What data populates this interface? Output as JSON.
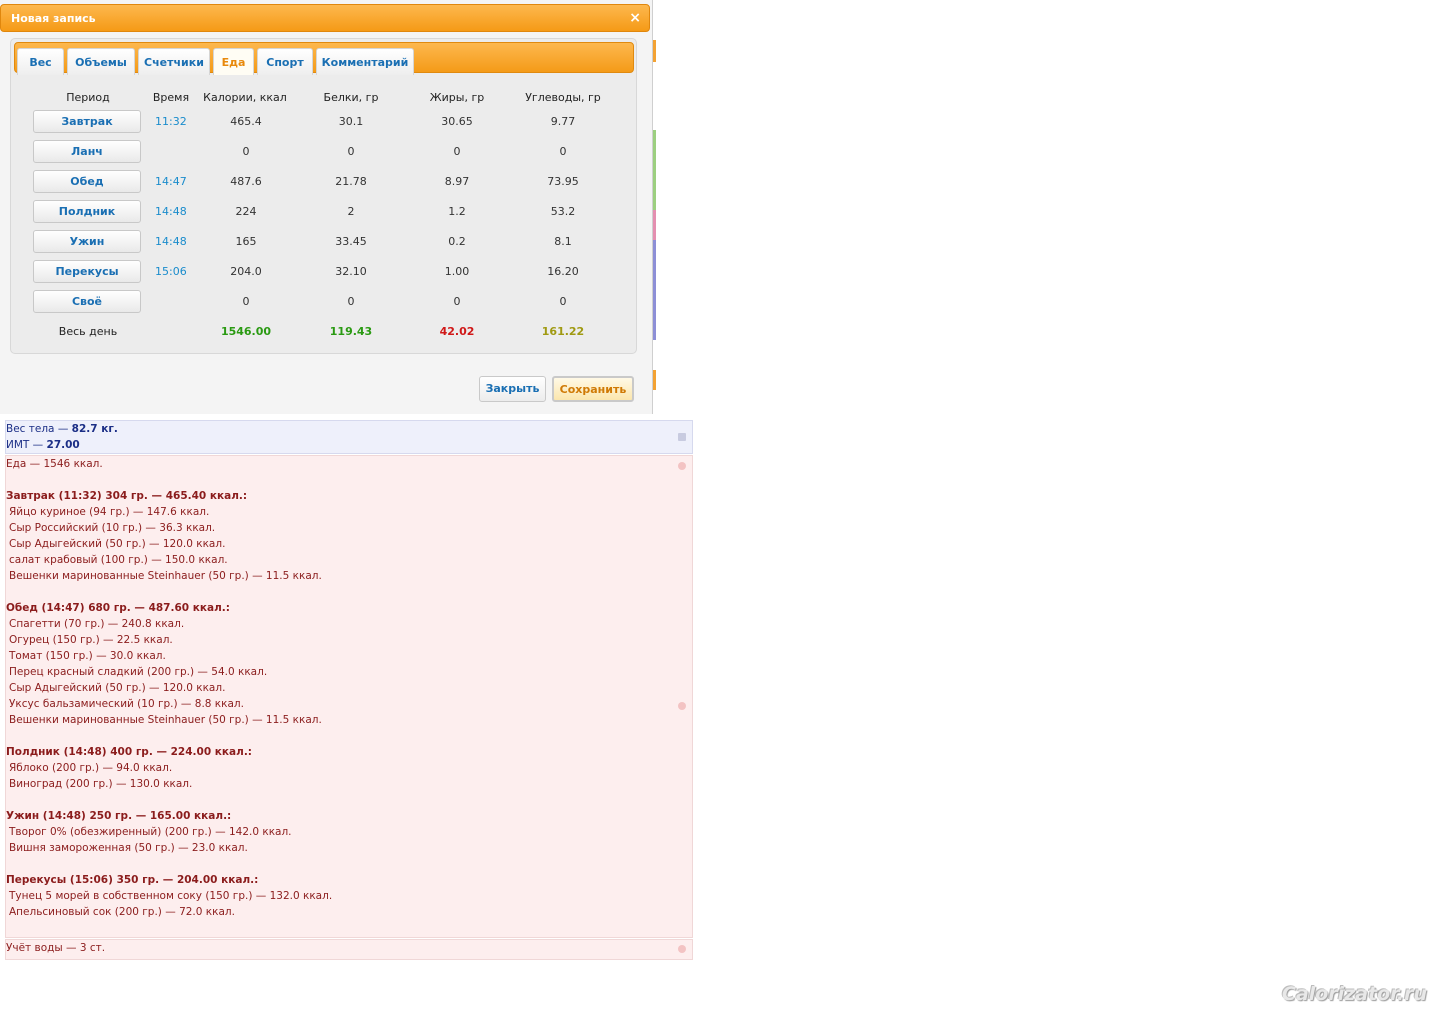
{
  "dialog": {
    "title": "Новая запись",
    "close_icon": "×",
    "tabs": [
      {
        "label": "Вес"
      },
      {
        "label": "Объемы"
      },
      {
        "label": "Счетчики"
      },
      {
        "label": "Еда",
        "active": true
      },
      {
        "label": "Спорт"
      },
      {
        "label": "Комментарий"
      }
    ],
    "table": {
      "headers": [
        "Период",
        "Время",
        "Калории, ккал",
        "Белки, гр",
        "Жиры, гр",
        "Углеводы, гр"
      ],
      "rows": [
        {
          "period": "Завтрак",
          "time": "11:32",
          "kcal": "465.4",
          "protein": "30.1",
          "fat": "30.65",
          "carbs": "9.77"
        },
        {
          "period": "Ланч",
          "time": "",
          "kcal": "0",
          "protein": "0",
          "fat": "0",
          "carbs": "0"
        },
        {
          "period": "Обед",
          "time": "14:47",
          "kcal": "487.6",
          "protein": "21.78",
          "fat": "8.97",
          "carbs": "73.95"
        },
        {
          "period": "Полдник",
          "time": "14:48",
          "kcal": "224",
          "protein": "2",
          "fat": "1.2",
          "carbs": "53.2"
        },
        {
          "period": "Ужин",
          "time": "14:48",
          "kcal": "165",
          "protein": "33.45",
          "fat": "0.2",
          "carbs": "8.1"
        },
        {
          "period": "Перекусы",
          "time": "15:06",
          "kcal": "204.0",
          "protein": "32.10",
          "fat": "1.00",
          "carbs": "16.20"
        },
        {
          "period": "Своё",
          "time": "",
          "kcal": "0",
          "protein": "0",
          "fat": "0",
          "carbs": "0"
        }
      ],
      "total": {
        "label": "Весь день",
        "kcal": "1546.00",
        "protein": "119.43",
        "fat": "42.02",
        "carbs": "161.22"
      }
    },
    "buttons": {
      "close": "Закрыть",
      "save": "Сохранить"
    },
    "colors": {
      "accent": "#f59a16",
      "link": "#1a6fb3",
      "kcal_total": "#2a9a12",
      "protein_total": "#2a9a12",
      "fat_total": "#d01818",
      "carbs_total": "#a09a12"
    }
  },
  "diary": {
    "weight": [
      {
        "text": "Вес тела — ",
        "value": "82.7 кг."
      },
      {
        "text": "ИМТ — ",
        "value": "27.00"
      }
    ],
    "food": [
      {
        "text": "Еда — 1546 ккал.",
        "bold": false
      },
      {
        "text": "",
        "bold": false
      },
      {
        "text": "Завтрак (11:32) 304 гр. — 465.40 ккал.:",
        "bold": true
      },
      {
        "text": "Яйцо куриное (94 гр.) — 147.6 ккал.",
        "item": true
      },
      {
        "text": "Сыр Российский (10 гр.) — 36.3 ккал.",
        "item": true
      },
      {
        "text": "Сыр Адыгейский (50 гр.) — 120.0 ккал.",
        "item": true
      },
      {
        "text": "салат крабовый (100 гр.) — 150.0 ккал.",
        "item": true
      },
      {
        "text": "Вешенки маринованные Steinhauer (50 гр.) — 11.5 ккал.",
        "item": true
      },
      {
        "text": "",
        "bold": false
      },
      {
        "text": "Обед (14:47) 680 гр. — 487.60 ккал.:",
        "bold": true
      },
      {
        "text": "Спагетти (70 гр.) — 240.8 ккал.",
        "item": true
      },
      {
        "text": "Огурец (150 гр.) — 22.5 ккал.",
        "item": true
      },
      {
        "text": "Томат (150 гр.) — 30.0 ккал.",
        "item": true
      },
      {
        "text": "Перец красный сладкий (200 гр.) — 54.0 ккал.",
        "item": true
      },
      {
        "text": "Сыр Адыгейский (50 гр.) — 120.0 ккал.",
        "item": true
      },
      {
        "text": "Уксус бальзамический (10 гр.) — 8.8 ккал.",
        "item": true
      },
      {
        "text": "Вешенки маринованные Steinhauer (50 гр.) — 11.5 ккал.",
        "item": true
      },
      {
        "text": "",
        "bold": false
      },
      {
        "text": "Полдник (14:48) 400 гр. — 224.00 ккал.:",
        "bold": true
      },
      {
        "text": "Яблоко (200 гр.) — 94.0 ккал.",
        "item": true
      },
      {
        "text": "Виноград (200 гр.) — 130.0 ккал.",
        "item": true
      },
      {
        "text": "",
        "bold": false
      },
      {
        "text": "Ужин (14:48) 250 гр. — 165.00 ккал.:",
        "bold": true
      },
      {
        "text": "Творог 0% (обезжиренный) (200 гр.) — 142.0 ккал.",
        "item": true
      },
      {
        "text": "Вишня замороженная (50 гр.) — 23.0 ккал.",
        "item": true
      },
      {
        "text": "",
        "bold": false
      },
      {
        "text": "Перекусы (15:06) 350 гр. — 204.00 ккал.:",
        "bold": true
      },
      {
        "text": "Тунец 5 морей в собственном соку (150 гр.) — 132.0 ккал.",
        "item": true
      },
      {
        "text": "Апельсиновый сок (200 гр.) — 72.0 ккал.",
        "item": true
      }
    ],
    "water": "Учёт воды — 3 ст."
  },
  "watermark": "Calorizator.ru"
}
